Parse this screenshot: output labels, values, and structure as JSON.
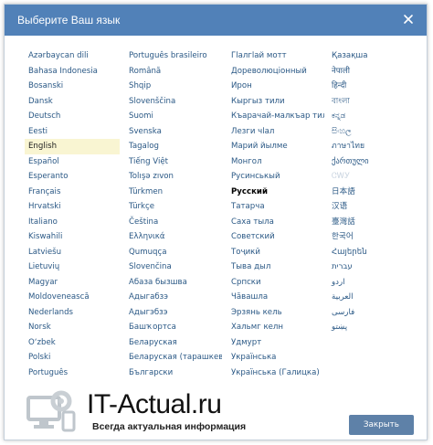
{
  "dialog": {
    "title": "Выберите Ваш язык",
    "close_icon": "close-icon",
    "close_button": "Закрыть",
    "accent_color": "#5181b8"
  },
  "languages": {
    "col1": [
      "Azərbaycan dili",
      "Bahasa Indonesia",
      "Bosanski",
      "Dansk",
      "Deutsch",
      "Eesti",
      "English",
      "Español",
      "Esperanto",
      "Français",
      "Hrvatski",
      "Italiano",
      "Kiswahili",
      "Latviešu",
      "Lietuvių",
      "Magyar",
      "Moldovenească",
      "Nederlands",
      "Norsk",
      "O‘zbek",
      "Polski",
      "Português"
    ],
    "col2": [
      "Português brasileiro",
      "Română",
      "Shqip",
      "Slovenščina",
      "Suomi",
      "Svenska",
      "Tagalog",
      "Tiếng Việt",
      "Tolışə zıvon",
      "Türkmen",
      "Türkçe",
      "Čeština",
      "Ελληνικά",
      "Qumuqça",
      "Slovenčina",
      "Абаза бызшва",
      "Адыгабзэ",
      "Адыгэбзэ",
      "Башҡортса",
      "Беларуская",
      "Беларуская (тарашкевіца)",
      "Български"
    ],
    "col3": [
      "Гӏалгӏай мотт",
      "Дореволюціонный",
      "Ирон",
      "Кыргыз тили",
      "Къарачай-малкъар тил",
      "Лезги чӏал",
      "Марий йылме",
      "Монгол",
      "Русинськый",
      "Русский",
      "Татарча",
      "Саха тыла",
      "Советский",
      "Тоҷикӣ",
      "Тыва дыл",
      "Српски",
      "Чӑвашла",
      "Эрзянь кель",
      "Хальмг келн",
      "Удмурт",
      "Українська",
      "Українська (Галицка)"
    ],
    "col4": [
      "Қазақша",
      "नेपाली",
      "हिन्दी",
      "বাংলা",
      "ಕನ್ನಡ",
      "සිංහල",
      "ภาษาไทย",
      "ქართული",
      "ᏣᎳᎩ",
      "日本語",
      "汉语",
      "臺灣話",
      "한국어",
      "Հայերեն",
      "עברית",
      "اردو",
      "العربية",
      "فارسی",
      "پښتو"
    ]
  },
  "selected_language": "English",
  "current_language": "Русский",
  "watermark": {
    "name": "IT-Actual.ru",
    "tagline": "Всегда актуальная информация",
    "icon": "computer-gear-icon"
  }
}
